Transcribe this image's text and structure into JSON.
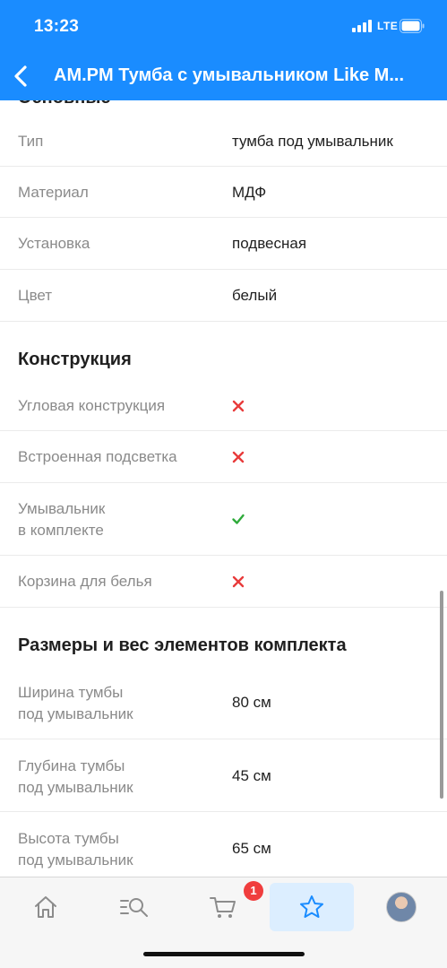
{
  "status_bar": {
    "time": "13:23",
    "network": "LTE"
  },
  "header": {
    "title": "AM.PM Тумба с умывальником Like M..."
  },
  "sections": [
    {
      "title": "Основные",
      "rows": [
        {
          "label": "Тип",
          "value": "тумба под умывальник"
        },
        {
          "label": "Материал",
          "value": "МДФ"
        },
        {
          "label": "Установка",
          "value": "подвесная"
        },
        {
          "label": "Цвет",
          "value": "белый"
        }
      ]
    },
    {
      "title": "Конструкция",
      "rows": [
        {
          "label": "Угловая конструкция",
          "value": "no"
        },
        {
          "label": "Встроенная подсветка",
          "value": "no"
        },
        {
          "label": "Умывальник\nв комплекте",
          "value": "yes"
        },
        {
          "label": "Корзина для белья",
          "value": "no"
        }
      ]
    },
    {
      "title": "Размеры и вес элементов комплекта",
      "rows": [
        {
          "label": "Ширина тумбы\nпод умывальник",
          "value": "80 см"
        },
        {
          "label": "Глубина тумбы\nпод умывальник",
          "value": "45 см"
        },
        {
          "label": "Высота тумбы\nпод умывальник",
          "value": "65 см"
        }
      ]
    }
  ],
  "nav": {
    "items": [
      "home-icon",
      "catalog-search-icon",
      "cart-icon",
      "favorites-star-icon",
      "profile-avatar"
    ],
    "active": "favorites-star-icon",
    "cart_badge": "1"
  },
  "colors": {
    "accent": "#1a8cff",
    "no_mark": "#e83b3b",
    "yes_mark": "#2eaa3a",
    "badge": "#f03d3d"
  }
}
